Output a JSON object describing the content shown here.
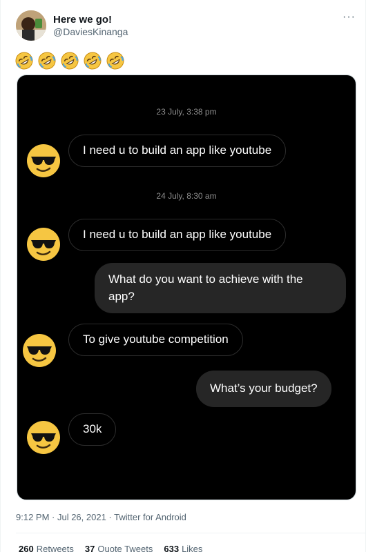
{
  "author": {
    "display_name": "Here we go!",
    "handle": "@DaviesKinanga"
  },
  "more_label": "···",
  "emoji_reactions": [
    "rofl-emoji",
    "rofl-emoji",
    "rofl-emoji",
    "rofl-emoji",
    "rofl-emoji"
  ],
  "chat": {
    "timestamp_1": "23 July, 3:38 pm",
    "timestamp_2": "24 July, 8:30 am",
    "msg_1": "I need u to build an app like youtube",
    "msg_2": "I need u to build an app like youtube",
    "msg_3": "What do you want to achieve with the app?",
    "msg_4": "To give youtube competition",
    "msg_5": "What’s your budget?",
    "msg_6": "30k"
  },
  "meta": {
    "posted": "9:12 PM · Jul 26, 2021 · Twitter for Android"
  },
  "stats": {
    "retweets_count": "260",
    "retweets_label": "Retweets",
    "quotes_count": "37",
    "quotes_label": "Quote Tweets",
    "likes_count": "633",
    "likes_label": "Likes"
  },
  "colors": {
    "incoming_border": "#2d2d2d",
    "outgoing_bg": "#262626",
    "emoji_yellow": "#f6c642"
  }
}
